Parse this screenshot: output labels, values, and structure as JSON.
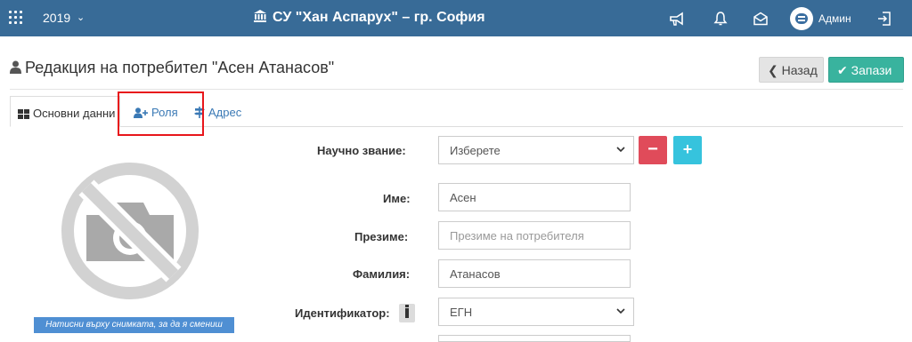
{
  "topbar": {
    "year": "2019",
    "school_title": "СУ \"Хан Аспарух\" – гр. София",
    "user_name": "Админ",
    "icons": [
      "apps-grid-icon",
      "chevron-down-icon",
      "bank-icon",
      "megaphone-icon",
      "bell-icon",
      "envelope-open-icon",
      "avatar",
      "sign-out-icon"
    ],
    "color": "#386b97"
  },
  "header": {
    "title": "Редакция на потребител \"Асен Атанасов\"",
    "back_label": "Назад",
    "save_label": "Запази"
  },
  "tabs": [
    {
      "label": "Основни данни",
      "icon": "th-large-icon",
      "active": true
    },
    {
      "label": "Роля",
      "icon": "user-plus-icon",
      "active": false
    },
    {
      "label": "Адрес",
      "icon": "map-signs-icon",
      "active": false
    }
  ],
  "photo": {
    "caption": "Натисни върху снимката, за да я смениш",
    "icon": "no-camera-icon"
  },
  "form": {
    "academic_title": {
      "label": "Научно звание:",
      "value": "Изберете"
    },
    "first_name": {
      "label": "Име:",
      "value": "Асен"
    },
    "middle_name": {
      "label": "Презиме:",
      "placeholder": "Презиме на потребителя"
    },
    "last_name": {
      "label": "Фамилия:",
      "value": "Атанасов"
    },
    "identifier": {
      "label": "Идентификатор:",
      "value": "ЕГН"
    }
  },
  "colors": {
    "accent_save": "#39b39e",
    "danger": "#e04b5a",
    "info": "#36c3dd",
    "highlight": "#e8161b"
  }
}
